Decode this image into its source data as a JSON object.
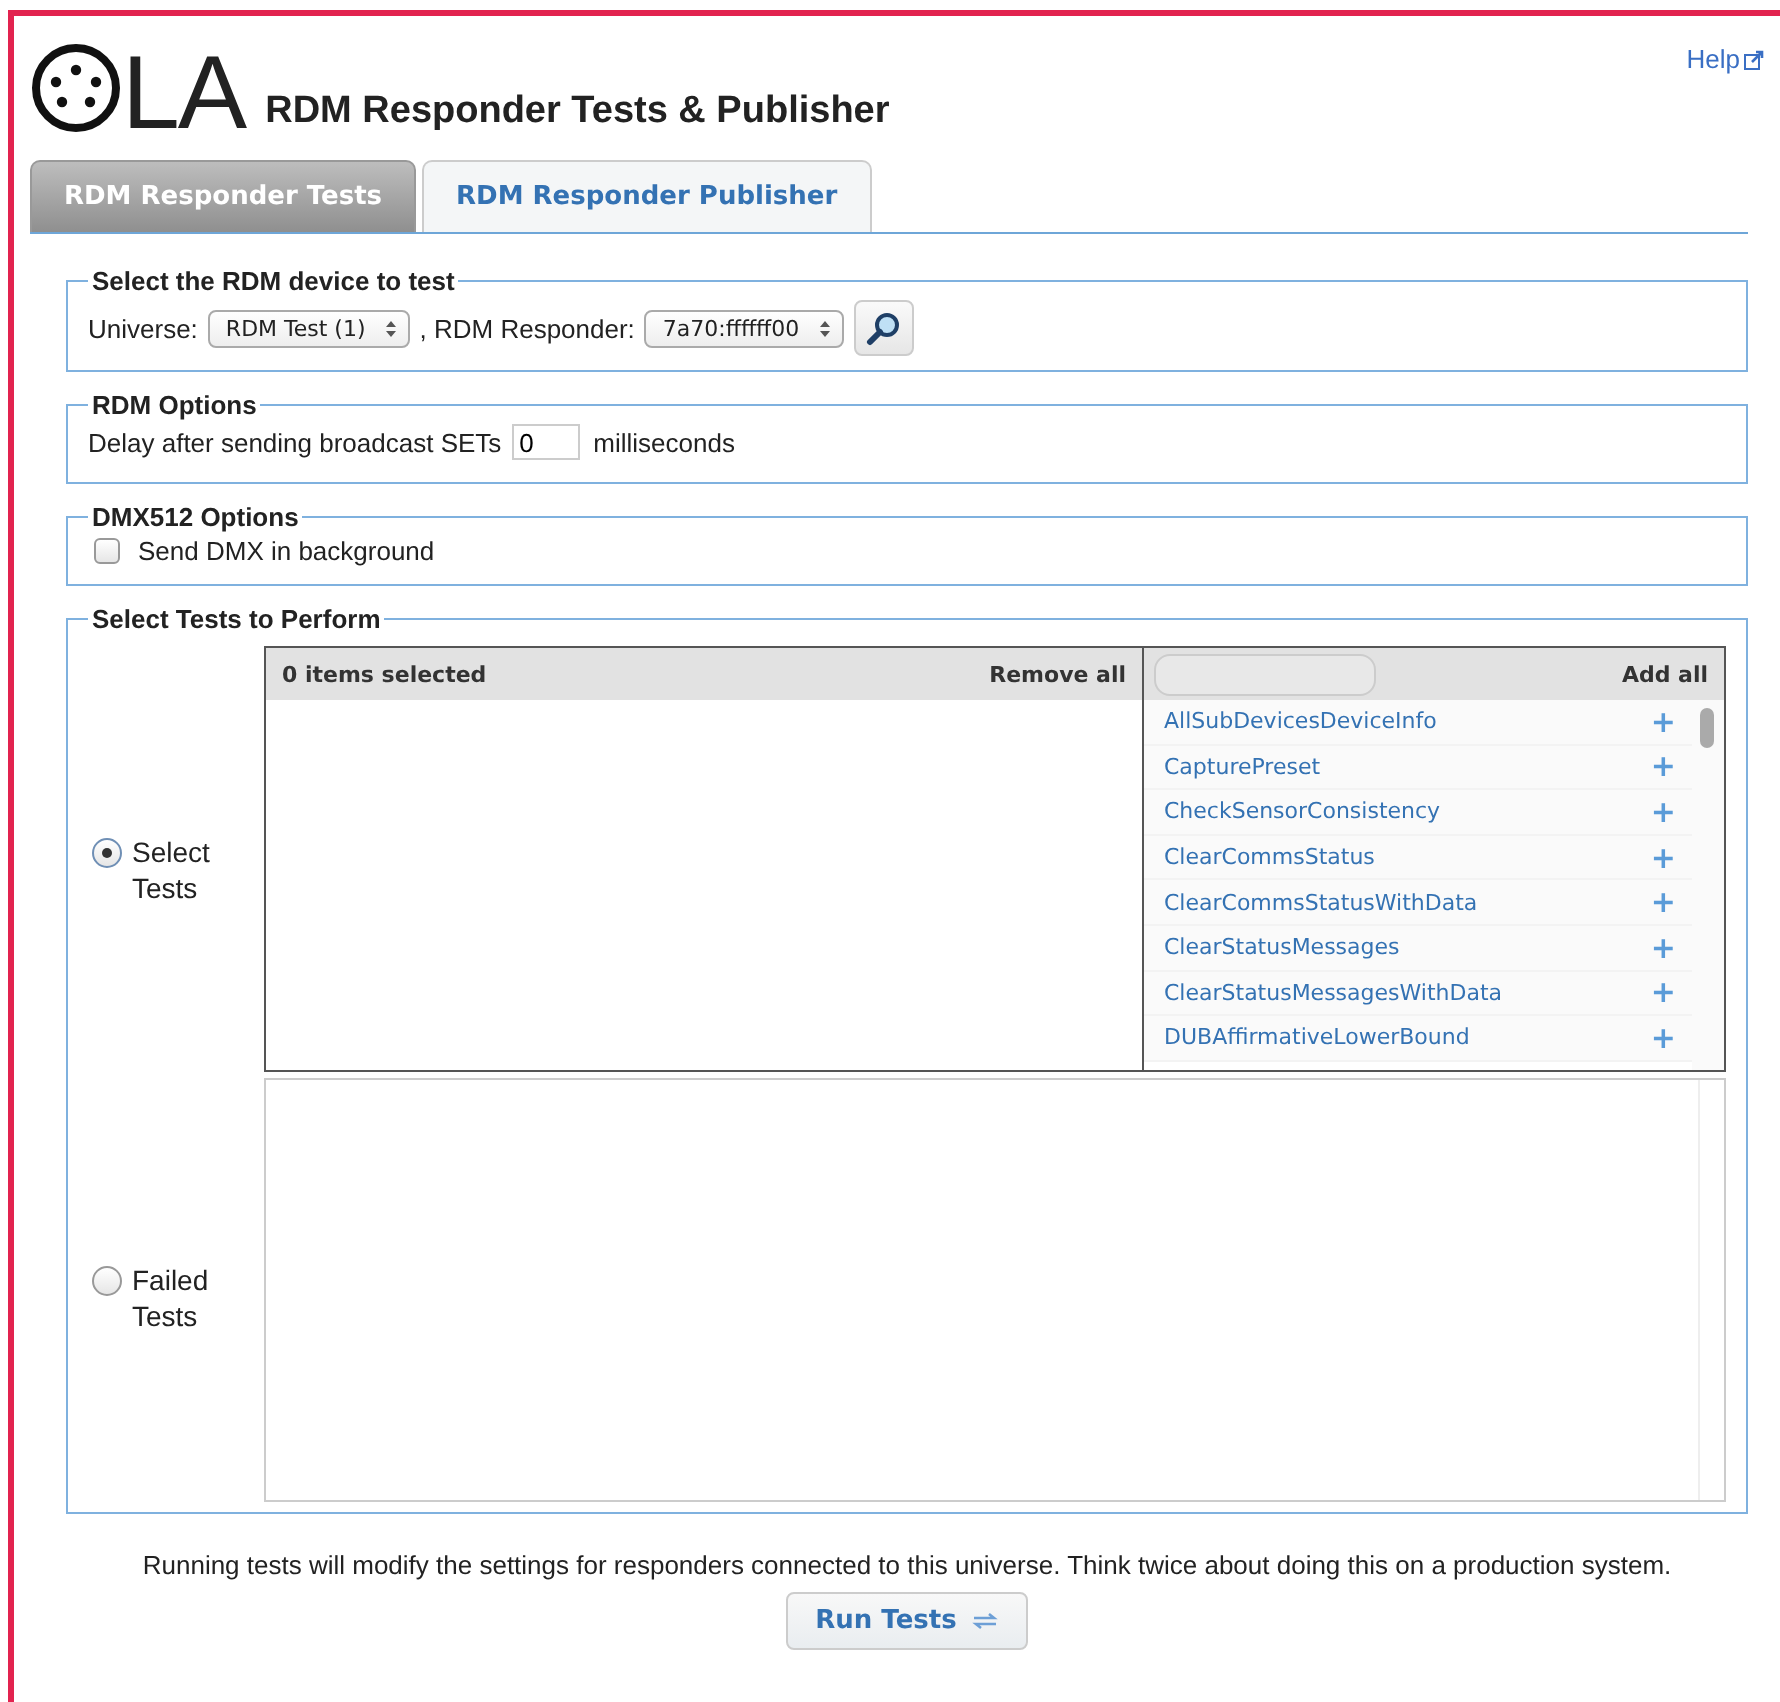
{
  "logo": {
    "text": "LA"
  },
  "title": "RDM Responder Tests & Publisher",
  "help_link": "Help",
  "tabs": [
    {
      "label": "RDM Responder Tests",
      "selected": true
    },
    {
      "label": "RDM Responder Publisher",
      "selected": false
    }
  ],
  "device_section": {
    "legend": "Select the RDM device to test",
    "universe_label": "Universe:",
    "universe_value": "RDM Test (1)",
    "responder_label": ", RDM Responder:",
    "responder_value": "7a70:ffffff00"
  },
  "rdm_options": {
    "legend": "RDM Options",
    "delay_label": "Delay after sending broadcast SETs",
    "delay_value": "0",
    "unit": "milliseconds"
  },
  "dmx_options": {
    "legend": "DMX512 Options",
    "send_dmx": {
      "label": "Send DMX in background",
      "checked": false
    }
  },
  "tests_section": {
    "legend": "Select Tests to Perform",
    "modes": [
      {
        "label": "Select Tests",
        "selected": true
      },
      {
        "label": "Failed Tests",
        "selected": false
      }
    ],
    "selected_header": "0 items selected",
    "remove_all": "Remove all",
    "add_all": "Add all",
    "available_tests": [
      "AllSubDevicesDeviceInfo",
      "CapturePreset",
      "CheckSensorConsistency",
      "ClearCommsStatus",
      "ClearCommsStatusWithData",
      "ClearStatusMessages",
      "ClearStatusMessagesWithData",
      "DUBAffirmativeLowerBound"
    ],
    "add_symbol": "+"
  },
  "warning": "Running tests will modify the settings for responders connected to this universe. Think twice about doing this on a production system.",
  "run_button": "Run Tests"
}
